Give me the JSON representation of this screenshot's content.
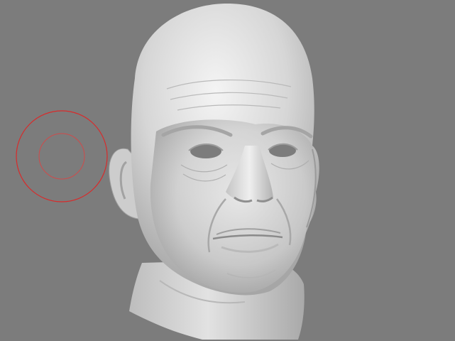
{
  "viewport": {
    "background_color": "#7c7c7c",
    "model": {
      "subject": "sculpted-head",
      "surface_color": "#d9d9d9"
    },
    "brush_cursor": {
      "color": "#d92a2a",
      "icon": "brush-radius-circles"
    }
  }
}
